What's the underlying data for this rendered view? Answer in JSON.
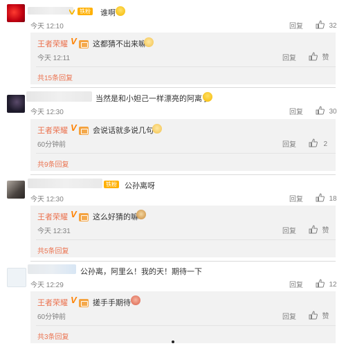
{
  "colors": {
    "accent": "#eb7350",
    "verified": "#ff8200",
    "fan_badge": "#ffb000"
  },
  "actions": {
    "reply": "回复",
    "like": "赞"
  },
  "comments": [
    {
      "badge": "铁粉",
      "text": "谁啊",
      "time": "今天 12:10",
      "likes": "32",
      "reply": {
        "name": "王者荣耀",
        "text": "这都猜不出来嘛",
        "time": "今天 12:11",
        "likes": "赞"
      },
      "more": "共15条回复"
    },
    {
      "text": "当然是和小妲己一样漂亮的阿离了",
      "time": "今天 12:30",
      "likes": "30",
      "reply": {
        "name": "王者荣耀",
        "text": "会说话就多说几句",
        "time": "60分钟前",
        "likes": "2"
      },
      "more": "共9条回复"
    },
    {
      "badge": "铁粉",
      "text": "公孙离呀",
      "time": "今天 12:30",
      "likes": "18",
      "reply": {
        "name": "王者荣耀",
        "text": "这么好猜的嘛",
        "time": "今天 12:31",
        "likes": "赞"
      },
      "more": "共5条回复"
    },
    {
      "text": "公孙离，阿里么！我的天！期待一下",
      "time": "今天 12:29",
      "likes": "12",
      "reply": {
        "name": "王者荣耀",
        "text": "搓手手期待",
        "time": "60分钟前",
        "likes": "赞"
      },
      "more": "共3条回复"
    }
  ]
}
